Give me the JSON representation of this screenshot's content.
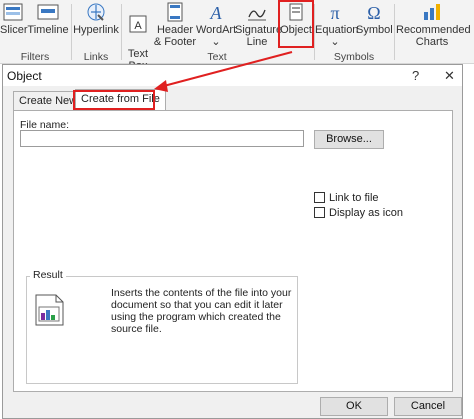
{
  "ribbon": {
    "items": [
      {
        "label": "Slicer"
      },
      {
        "label": "Timeline"
      },
      {
        "label": "Hyperlink"
      },
      {
        "label": "Text\nBox"
      },
      {
        "label": "Header\n& Footer"
      },
      {
        "label": "WordArt"
      },
      {
        "label": "Signature\nLine"
      },
      {
        "label": "Object"
      },
      {
        "label": "Equation"
      },
      {
        "label": "Symbol"
      },
      {
        "label": "Recommended\nCharts"
      }
    ],
    "groups": {
      "filters": "Filters",
      "links": "Links",
      "text": "Text",
      "symbols": "Symbols"
    },
    "accent": "#e02020"
  },
  "dialog": {
    "title": "Object",
    "help": "?",
    "close": "✕",
    "tabs": [
      "Create New",
      "Create from File"
    ],
    "file_name_label": "File name:",
    "file_name_value": "",
    "browse_label": "Browse...",
    "link_to_file": "Link to file",
    "display_as_icon": "Display as icon",
    "result_label": "Result",
    "result_text": "Inserts the contents of the file into your document so that you can edit it later using the program which created the source file.",
    "ok_label": "OK",
    "cancel_label": "Cancel"
  }
}
